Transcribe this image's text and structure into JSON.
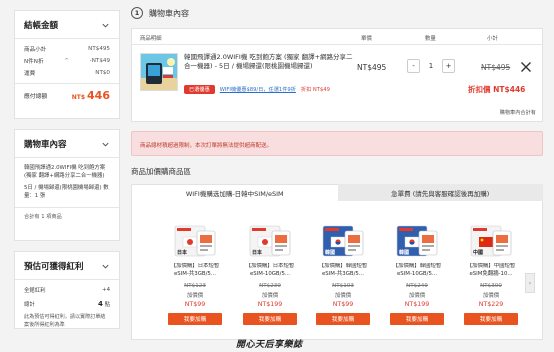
{
  "summary": {
    "title": "結帳金額",
    "rows": [
      {
        "label": "商品小計",
        "value": "NT$495"
      },
      {
        "label": "N件N折",
        "value": "-NT$49"
      },
      {
        "label": "運費",
        "value": "NT$0"
      }
    ],
    "total_label": "應付總額",
    "total_currency": "NT$",
    "total_amount": "446"
  },
  "cart_side": {
    "title": "購物車內容",
    "item_text": "韓國飛譯通2.0WIFI機 吃到飽方案 (獨家 翻譯+網路分享二合一機器)",
    "item_sub": "5日 / 機場歸還(限桃園機場歸還) 數量：1 張",
    "count_text": "合計有 1 項商品"
  },
  "bonus": {
    "title": "預估可獲得紅利",
    "rows": [
      {
        "label": "全館紅利",
        "value": "+4"
      },
      {
        "label": "總計",
        "value": "4",
        "unit": "點"
      }
    ],
    "note": "此為預估可得紅利，請以實際訂單結案後所得紅利為準"
  },
  "cart": {
    "step": "1",
    "title": "購物車內容",
    "columns": {
      "product": "商品明細",
      "unit": "單價",
      "qty": "數量",
      "subtotal": "小計"
    },
    "item": {
      "name": "韓國飛譯通2.0WIFI機 吃到飽方案 (獨家 翻譯+網路分享二合一機器) - 5日 / 機場歸還(限桃園機場歸還)",
      "tag_red": "已選優惠",
      "tag_link": "WIFI機優惠$89/日，任選1件9折",
      "tag_disc": "折扣 NT$49",
      "unit_price": "NT$495",
      "qty": "1",
      "minus": "-",
      "plus": "+",
      "orig_price": "NT$495",
      "disc_price": "折扣價 NT$446"
    },
    "total_label": "購物車內合計有"
  },
  "alert": {
    "text": "商品總材積超過限制，本次訂單將無法提供超商配送。"
  },
  "addon": {
    "title": "商品加價購商品區",
    "tabs": [
      "WIFI機購选加購-日韓中SIM/eSIM",
      "急單費 (請先與客服確認後再加購)"
    ],
    "items": [
      {
        "name": "【加價購】日本短暫eSIM-共3GB/5...",
        "orig": "NT$123",
        "label": "加價價",
        "price": "NT$99",
        "button": "我要加購",
        "img_text": "日本",
        "flag": "jp"
      },
      {
        "name": "【加價購】日本短暫eSIM-10GB/5...",
        "orig": "NT$239",
        "label": "加價價",
        "price": "NT$199",
        "button": "我要加購",
        "img_text": "日本",
        "flag": "jp"
      },
      {
        "name": "【加價購】韓國短暫eSIM-共3GB/5...",
        "orig": "NT$103",
        "label": "加價價",
        "price": "NT$99",
        "button": "我要加購",
        "img_text": "韓國",
        "flag": "kr"
      },
      {
        "name": "【加價購】韓國短暫eSIM-10GB/5...",
        "orig": "NT$249",
        "label": "加價價",
        "price": "NT$199",
        "button": "我要加購",
        "img_text": "韓國",
        "flag": "kr"
      },
      {
        "name": "【加價購】中國短暫eSIM免翻牆-10...",
        "orig": "NT$300",
        "label": "加價價",
        "price": "NT$229",
        "button": "我要加購",
        "img_text": "中國",
        "flag": "cn"
      }
    ],
    "next_arrow": "›"
  },
  "footer": {
    "caption": "開心天后享樂誌"
  },
  "colors": {
    "accent": "#e8531f",
    "discount": "#e03a2f",
    "link": "#2d6fc6",
    "alert_bg": "#f8dede"
  }
}
